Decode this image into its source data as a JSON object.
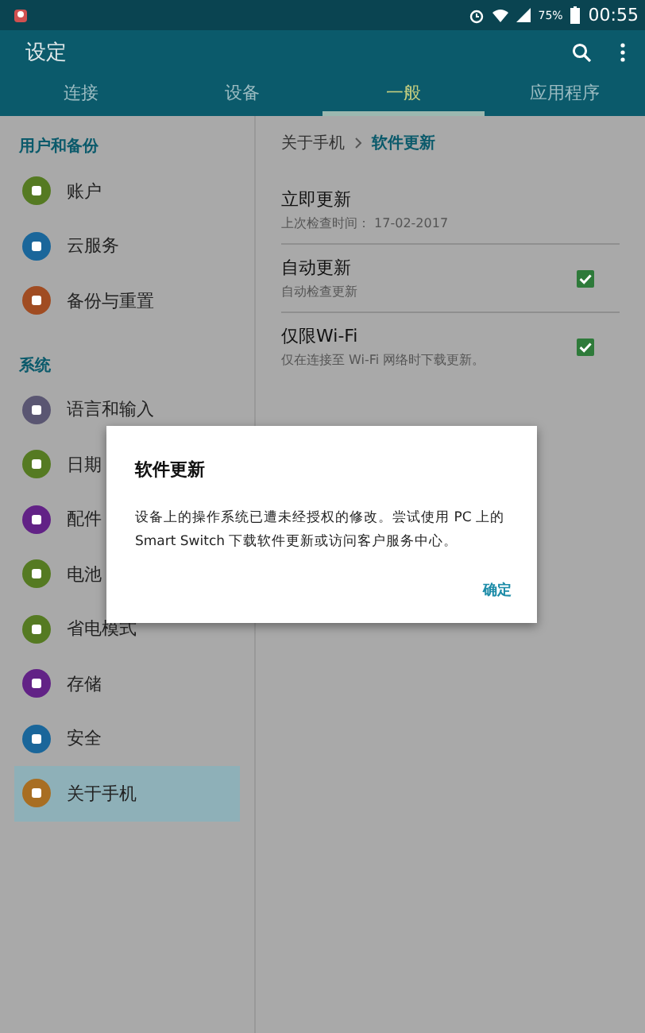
{
  "status_bar": {
    "battery": "75%",
    "time": "00:55"
  },
  "app_bar": {
    "title": "设定"
  },
  "tabs": [
    {
      "label": "连接",
      "selected": false
    },
    {
      "label": "设备",
      "selected": false
    },
    {
      "label": "一般",
      "selected": true
    },
    {
      "label": "应用程序",
      "selected": false
    }
  ],
  "sidebar": {
    "sections": [
      {
        "header": "用户和备份",
        "items": [
          {
            "label": "账户",
            "color": "#557a22",
            "selected": false
          },
          {
            "label": "云服务",
            "color": "#1a669a",
            "selected": false
          },
          {
            "label": "备份与重置",
            "color": "#a04c22",
            "selected": false
          }
        ]
      },
      {
        "header": "系统",
        "items": [
          {
            "label": "语言和输入",
            "color": "#5a5672",
            "selected": false
          },
          {
            "label": "日期",
            "color": "#557a22",
            "selected": false
          },
          {
            "label": "配件",
            "color": "#622286",
            "selected": false
          },
          {
            "label": "电池",
            "color": "#557a22",
            "selected": false
          },
          {
            "label": "省电模式",
            "color": "#557a22",
            "selected": false
          },
          {
            "label": "存储",
            "color": "#622286",
            "selected": false
          },
          {
            "label": "安全",
            "color": "#1a669a",
            "selected": false
          },
          {
            "label": "关于手机",
            "color": "#a86e22",
            "selected": true
          }
        ]
      }
    ]
  },
  "breadcrumb": {
    "parent": "关于手机",
    "current": "软件更新"
  },
  "settings": [
    {
      "kind": "action",
      "title": "立即更新",
      "subtitle": "上次检查时间： 17-02-2017"
    },
    {
      "kind": "checkbox",
      "title": "自动更新",
      "subtitle": "自动检查更新",
      "checked": true
    },
    {
      "kind": "checkbox",
      "title": "仅限Wi-Fi",
      "subtitle": "仅在连接至 Wi-Fi 网络时下载更新。",
      "checked": true
    }
  ],
  "dialog": {
    "title": "软件更新",
    "message": "设备上的操作系统已遭未经授权的修改。尝试使用 PC 上的 Smart Switch 下载软件更新或访问客户服务中心。",
    "button": "确定"
  }
}
